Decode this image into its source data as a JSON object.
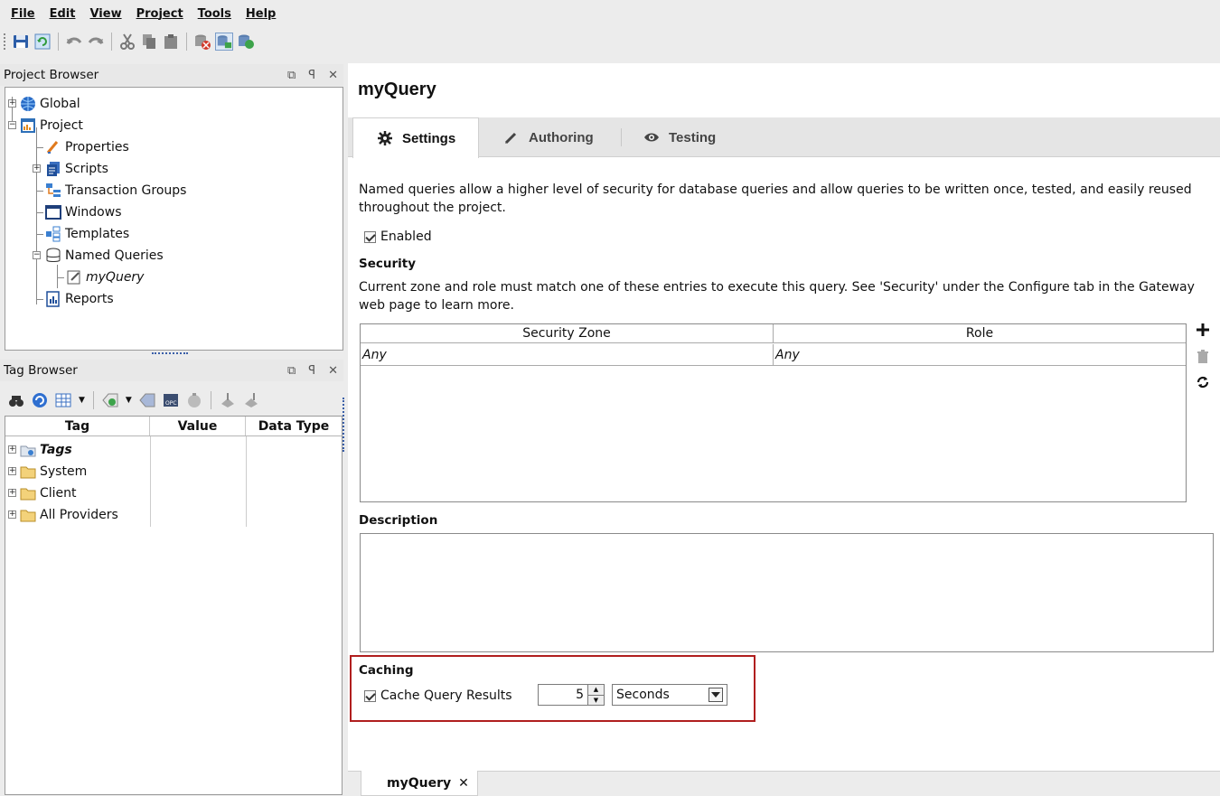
{
  "menu": [
    "File",
    "Edit",
    "View",
    "Project",
    "Tools",
    "Help"
  ],
  "toolbar_icons": [
    "save-icon",
    "refresh-icon",
    "undo-icon",
    "redo-icon",
    "cut-icon",
    "copy-icon",
    "paste-icon",
    "db-disconnect-icon",
    "db-connect-icon",
    "db-sync-icon"
  ],
  "project_browser": {
    "title": "Project Browser",
    "items": [
      {
        "label": "Global",
        "icon": "globe-icon"
      },
      {
        "label": "Project",
        "icon": "project-icon"
      },
      {
        "label": "Properties",
        "icon": "properties-icon"
      },
      {
        "label": "Scripts",
        "icon": "scripts-icon"
      },
      {
        "label": "Transaction Groups",
        "icon": "transaction-groups-icon"
      },
      {
        "label": "Windows",
        "icon": "window-icon"
      },
      {
        "label": "Templates",
        "icon": "templates-icon"
      },
      {
        "label": "Named Queries",
        "icon": "database-icon"
      },
      {
        "label": "myQuery",
        "icon": "query-icon"
      },
      {
        "label": "Reports",
        "icon": "report-icon"
      }
    ]
  },
  "tag_browser": {
    "title": "Tag Browser",
    "columns": [
      "Tag",
      "Value",
      "Data Type"
    ],
    "items": [
      "Tags",
      "System",
      "Client",
      "All Providers"
    ]
  },
  "editor": {
    "title": "myQuery",
    "tabs": [
      {
        "label": "Settings",
        "icon": "gear-icon"
      },
      {
        "label": "Authoring",
        "icon": "pencil-icon"
      },
      {
        "label": "Testing",
        "icon": "eye-icon"
      }
    ],
    "intro": "Named queries allow a higher level of security for database queries and allow queries to be written once, tested, and easily reused throughout the project.",
    "enabled_label": "Enabled",
    "security": {
      "label": "Security",
      "description": "Current zone and role must match one of these entries to execute this query. See 'Security' under the Configure tab in the Gateway web page to learn more.",
      "columns": [
        "Security Zone",
        "Role"
      ],
      "rows": [
        [
          "Any",
          "Any"
        ]
      ]
    },
    "description_label": "Description",
    "caching": {
      "label": "Caching",
      "checkbox_label": "Cache Query Results",
      "value": "5",
      "unit": "Seconds"
    }
  },
  "doc_tab": {
    "label": "myQuery",
    "close": "✕"
  }
}
